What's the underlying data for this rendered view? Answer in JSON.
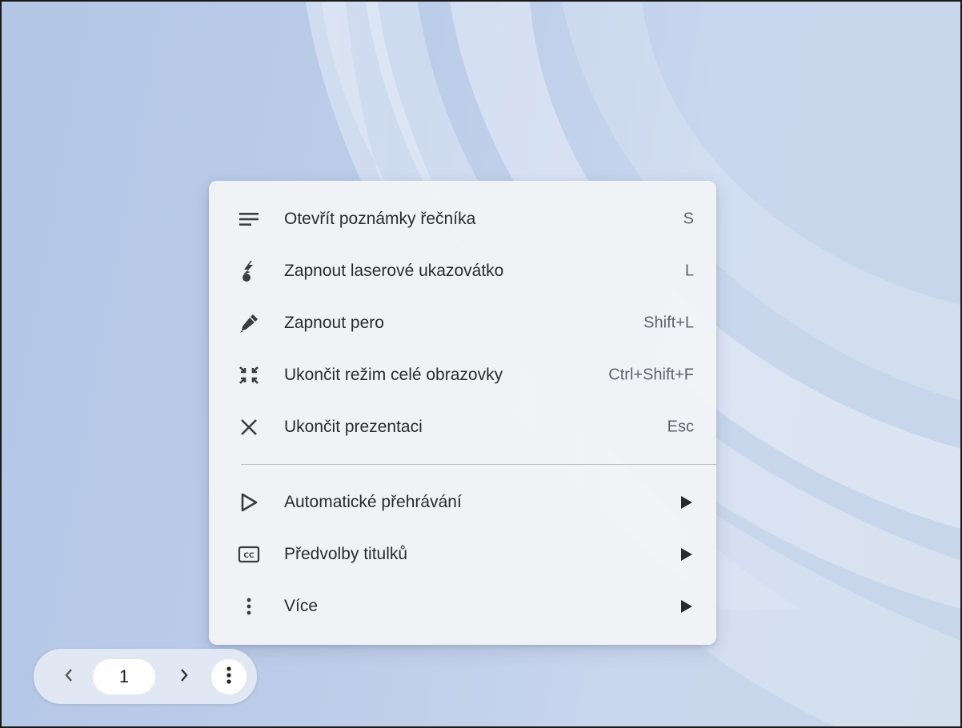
{
  "menu": {
    "items": [
      {
        "label": "Otevřít poznámky řečníka",
        "shortcut": "S",
        "icon": "notes-icon"
      },
      {
        "label": "Zapnout laserové ukazovátko",
        "shortcut": "L",
        "icon": "laser-pointer-icon"
      },
      {
        "label": "Zapnout pero",
        "shortcut": "Shift+L",
        "icon": "pen-icon"
      },
      {
        "label": "Ukončit režim celé obrazovky",
        "shortcut": "Ctrl+Shift+F",
        "icon": "exit-fullscreen-icon"
      },
      {
        "label": "Ukončit prezentaci",
        "shortcut": "Esc",
        "icon": "close-icon"
      }
    ],
    "submenus": [
      {
        "label": "Automatické přehrávání",
        "icon": "play-icon"
      },
      {
        "label": "Předvolby titulků",
        "icon": "captions-icon"
      },
      {
        "label": "Více",
        "icon": "more-vert-icon"
      }
    ]
  },
  "nav": {
    "page": "1",
    "prev_icon": "chevron-left-icon",
    "next_icon": "chevron-right-icon",
    "more_icon": "more-vert-icon"
  },
  "colors": {
    "background": "#bccde9",
    "menu_bg": "#f2f3f6",
    "text": "#2b2b2b",
    "shortcut": "#5f6368"
  }
}
